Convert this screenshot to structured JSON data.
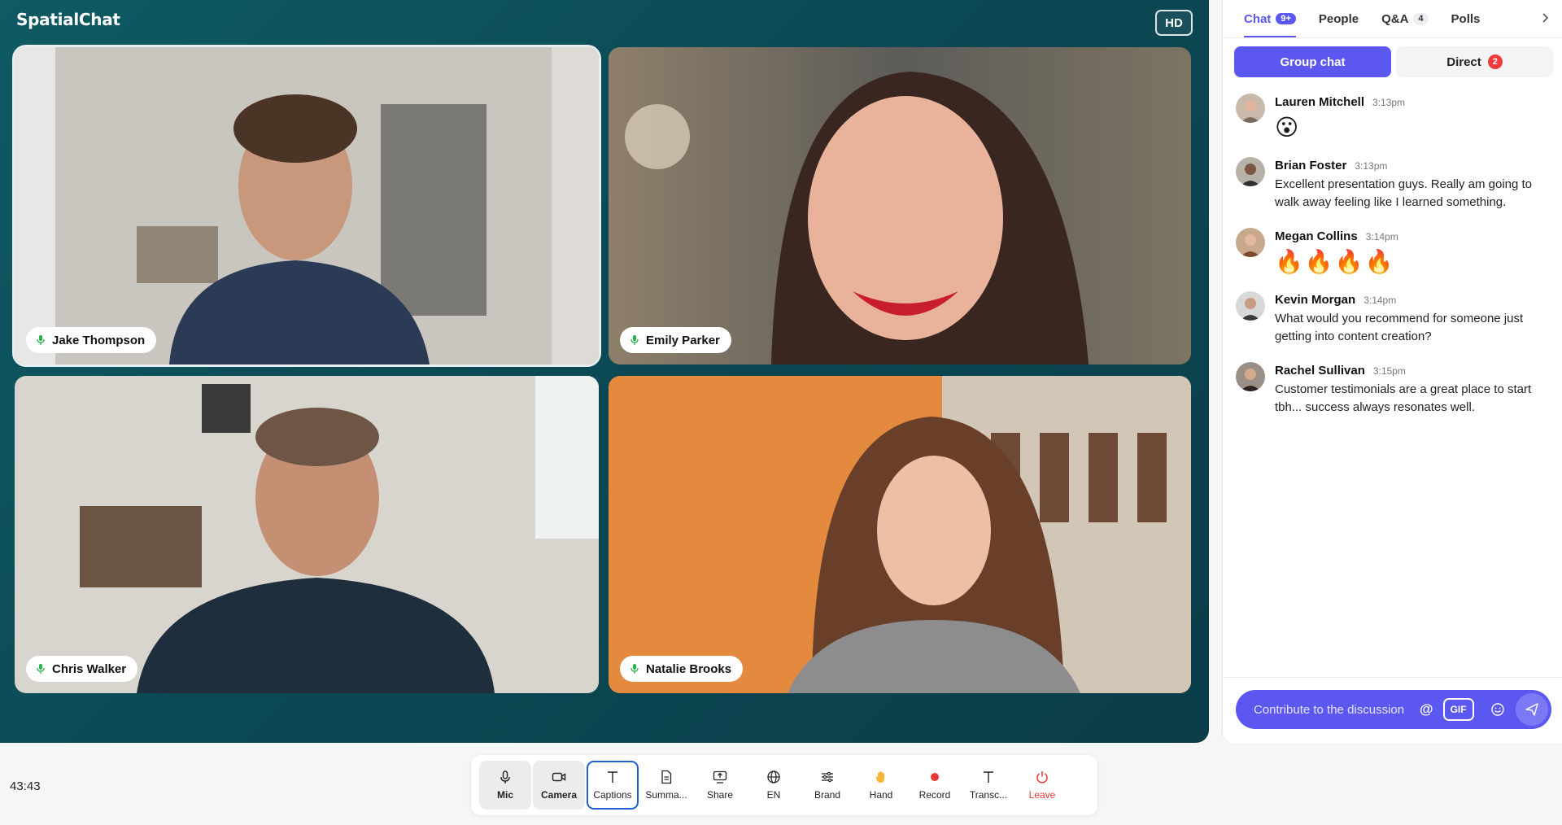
{
  "app": {
    "logo": "SpatialChat",
    "quality_badge": "HD"
  },
  "participants": [
    {
      "name": "Jake Thompson",
      "active_speaker": true
    },
    {
      "name": "Emily Parker",
      "active_speaker": false
    },
    {
      "name": "Chris Walker",
      "active_speaker": false
    },
    {
      "name": "Natalie Brooks",
      "active_speaker": false
    }
  ],
  "panel": {
    "tabs": [
      {
        "label": "Chat",
        "badge": "9+",
        "active": true
      },
      {
        "label": "People",
        "badge": ""
      },
      {
        "label": "Q&A",
        "badge": "4"
      },
      {
        "label": "Polls",
        "badge": ""
      }
    ],
    "segments": {
      "group": "Group chat",
      "direct": "Direct",
      "direct_badge": "2"
    },
    "messages": [
      {
        "name": "Lauren Mitchell",
        "time": "3:13pm",
        "text": "",
        "emoji": "😮"
      },
      {
        "name": "Brian Foster",
        "time": "3:13pm",
        "text": "Excellent presentation guys. Really am going to walk away feeling like I learned something.",
        "emoji": ""
      },
      {
        "name": "Megan Collins",
        "time": "3:14pm",
        "text": "",
        "emoji": "🔥🔥🔥🔥"
      },
      {
        "name": "Kevin Morgan",
        "time": "3:14pm",
        "text": "What would you recommend for someone just getting into content creation?",
        "emoji": ""
      },
      {
        "name": "Rachel Sullivan",
        "time": "3:15pm",
        "text": "Customer testimonials are a great place to start tbh... success always resonates well.",
        "emoji": ""
      }
    ],
    "composer": {
      "placeholder": "Contribute to the discussion",
      "mention": "@",
      "gif": "GIF"
    }
  },
  "timer": "43:43",
  "toolbar": {
    "mic": "Mic",
    "camera": "Camera",
    "captions": "Captions",
    "summary": "Summa...",
    "share": "Share",
    "language": "EN",
    "brand": "Brand",
    "hand": "Hand",
    "record": "Record",
    "transcript": "Transc...",
    "leave": "Leave"
  },
  "colors": {
    "accent": "#5b57f0",
    "stage": "#0b4a55",
    "leave": "#e53935",
    "record": "#e53935"
  }
}
